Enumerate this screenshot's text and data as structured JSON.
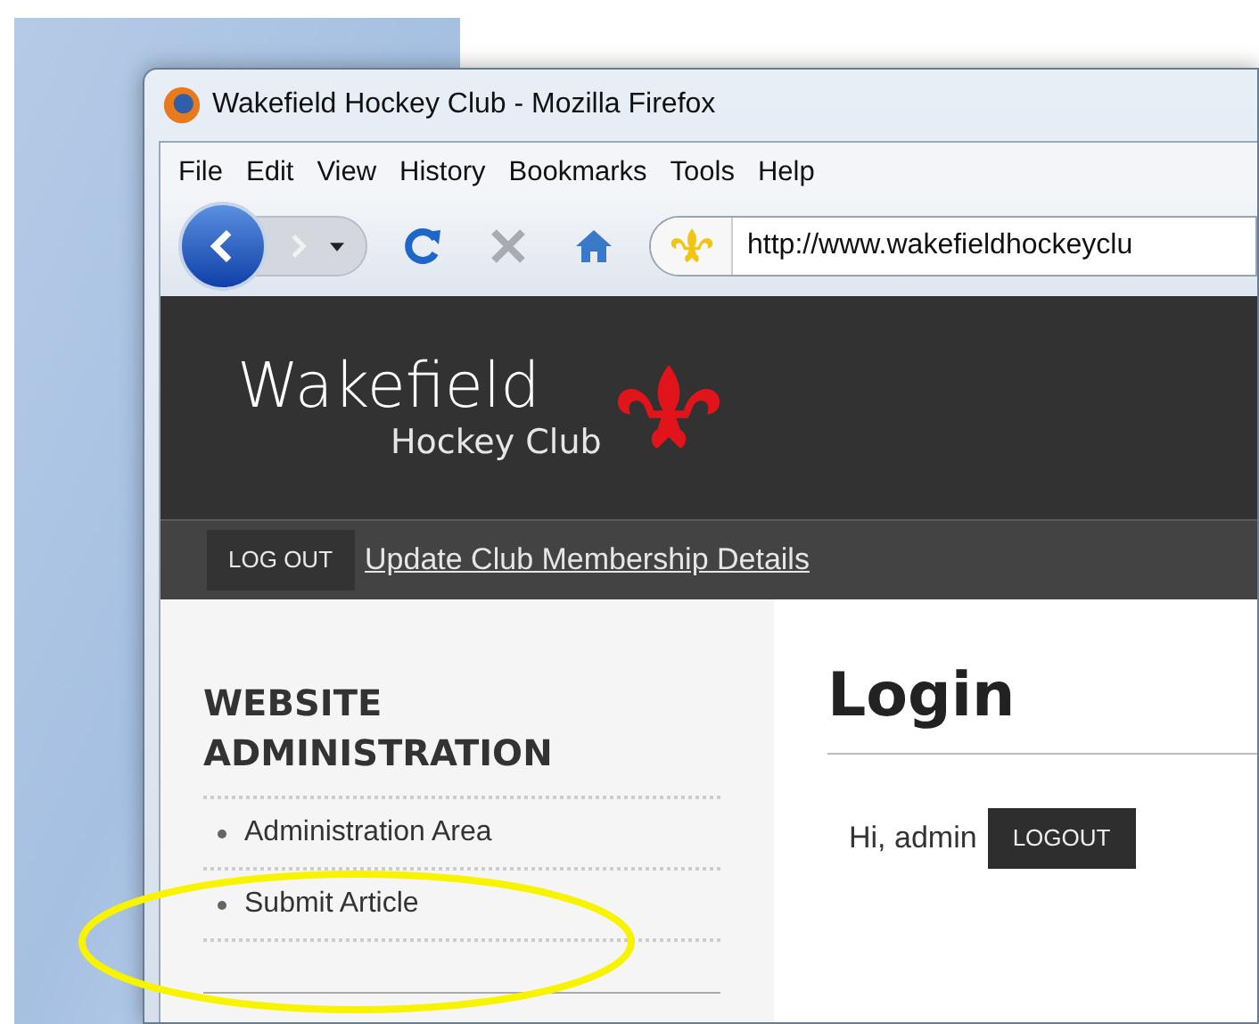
{
  "window": {
    "title": "Wakefield Hockey Club - Mozilla Firefox"
  },
  "menu": [
    {
      "label": "File"
    },
    {
      "label": "Edit"
    },
    {
      "label": "View"
    },
    {
      "label": "History"
    },
    {
      "label": "Bookmarks"
    },
    {
      "label": "Tools"
    },
    {
      "label": "Help"
    }
  ],
  "toolbar": {
    "address": "http://www.wakefieldhockeyclu",
    "forward_disabled": true,
    "stop_disabled": true
  },
  "site": {
    "logo_title": "Wakefield",
    "logo_subtitle": "Hockey Club",
    "nav_button": "LOG OUT",
    "nav_link": "Update Club Membership Details"
  },
  "sidebar": {
    "heading": "WEBSITE ADMINISTRATION",
    "items": [
      "Administration Area",
      "Submit Article"
    ]
  },
  "main": {
    "title": "Login",
    "greeting": "Hi, admin",
    "button": "LOGOUT"
  }
}
